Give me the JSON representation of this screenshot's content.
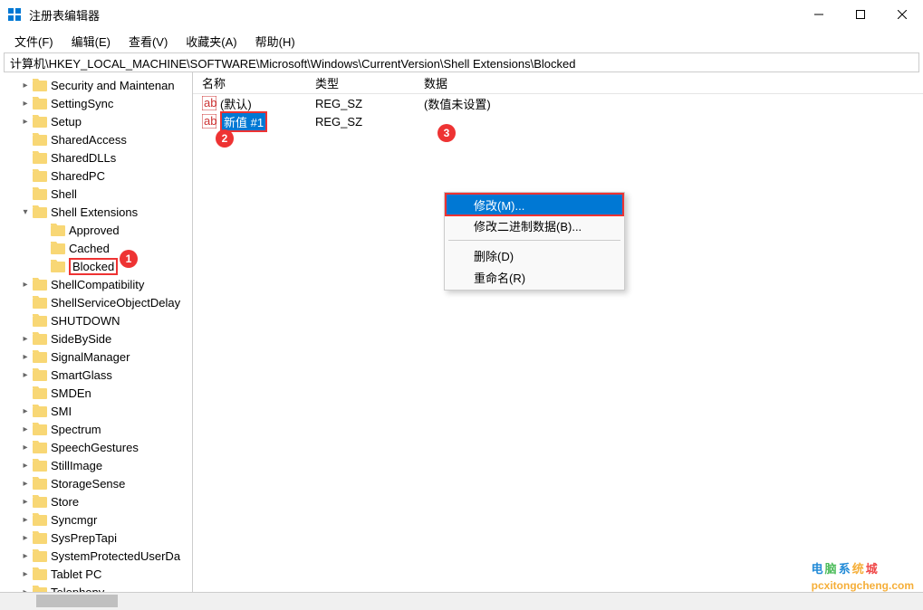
{
  "window": {
    "title": "注册表编辑器"
  },
  "menu": {
    "file": "文件(F)",
    "edit": "编辑(E)",
    "view": "查看(V)",
    "favorites": "收藏夹(A)",
    "help": "帮助(H)"
  },
  "address": "计算机\\HKEY_LOCAL_MACHINE\\SOFTWARE\\Microsoft\\Windows\\CurrentVersion\\Shell Extensions\\Blocked",
  "tree": [
    {
      "label": "Security and Maintenan",
      "indent": 1,
      "chev": "right"
    },
    {
      "label": "SettingSync",
      "indent": 1,
      "chev": "right"
    },
    {
      "label": "Setup",
      "indent": 1,
      "chev": "right"
    },
    {
      "label": "SharedAccess",
      "indent": 1,
      "chev": "none"
    },
    {
      "label": "SharedDLLs",
      "indent": 1,
      "chev": "none"
    },
    {
      "label": "SharedPC",
      "indent": 1,
      "chev": "none"
    },
    {
      "label": "Shell",
      "indent": 1,
      "chev": "none"
    },
    {
      "label": "Shell Extensions",
      "indent": 1,
      "chev": "down"
    },
    {
      "label": "Approved",
      "indent": 2,
      "chev": "none"
    },
    {
      "label": "Cached",
      "indent": 2,
      "chev": "none"
    },
    {
      "label": "Blocked",
      "indent": 2,
      "chev": "none",
      "hi": 1
    },
    {
      "label": "ShellCompatibility",
      "indent": 1,
      "chev": "right"
    },
    {
      "label": "ShellServiceObjectDelay",
      "indent": 1,
      "chev": "none"
    },
    {
      "label": "SHUTDOWN",
      "indent": 1,
      "chev": "none"
    },
    {
      "label": "SideBySide",
      "indent": 1,
      "chev": "right"
    },
    {
      "label": "SignalManager",
      "indent": 1,
      "chev": "right"
    },
    {
      "label": "SmartGlass",
      "indent": 1,
      "chev": "right"
    },
    {
      "label": "SMDEn",
      "indent": 1,
      "chev": "none"
    },
    {
      "label": "SMI",
      "indent": 1,
      "chev": "right"
    },
    {
      "label": "Spectrum",
      "indent": 1,
      "chev": "right"
    },
    {
      "label": "SpeechGestures",
      "indent": 1,
      "chev": "right"
    },
    {
      "label": "StillImage",
      "indent": 1,
      "chev": "right"
    },
    {
      "label": "StorageSense",
      "indent": 1,
      "chev": "right"
    },
    {
      "label": "Store",
      "indent": 1,
      "chev": "right"
    },
    {
      "label": "Syncmgr",
      "indent": 1,
      "chev": "right"
    },
    {
      "label": "SysPrepTapi",
      "indent": 1,
      "chev": "right"
    },
    {
      "label": "SystemProtectedUserDa",
      "indent": 1,
      "chev": "right"
    },
    {
      "label": "Tablet PC",
      "indent": 1,
      "chev": "right"
    },
    {
      "label": "Telephony",
      "indent": 1,
      "chev": "right"
    }
  ],
  "list": {
    "cols": {
      "name": "名称",
      "type": "类型",
      "data": "数据"
    },
    "rows": [
      {
        "name": "(默认)",
        "type": "REG_SZ",
        "data": "(数值未设置)",
        "editing": false
      },
      {
        "name": "新值 #1",
        "type": "REG_SZ",
        "data": "",
        "editing": true
      }
    ]
  },
  "contextmenu": {
    "modify": "修改(M)...",
    "modify_binary": "修改二进制数据(B)...",
    "delete": "删除(D)",
    "rename": "重命名(R)"
  },
  "badges": {
    "b1": "1",
    "b2": "2",
    "b3": "3"
  },
  "watermark": {
    "text": "电脑系统城",
    "url": "pcxitongcheng.com"
  }
}
